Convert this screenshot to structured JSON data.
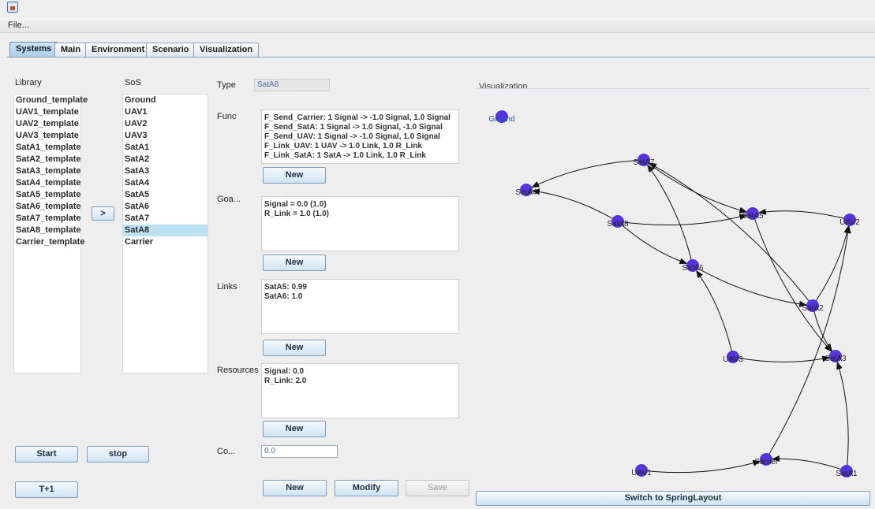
{
  "menu": {
    "file": "File..."
  },
  "tabs": [
    "Systems",
    "Main",
    "Environment",
    "Scenario",
    "Visualization"
  ],
  "library": {
    "label": "Library",
    "items": [
      "Ground_template",
      "UAV1_template",
      "UAV2_template",
      "UAV3_template",
      "SatA1_template",
      "SatA2_template",
      "SatA3_template",
      "SatA4_template",
      "SatA5_template",
      "SatA6_template",
      "SatA7_template",
      "SatA8_template",
      "Carrier_template"
    ]
  },
  "sos": {
    "label": "SoS",
    "items": [
      "Ground",
      "UAV1",
      "UAV2",
      "UAV3",
      "SatA1",
      "SatA2",
      "SatA3",
      "SatA4",
      "SatA5",
      "SatA6",
      "SatA7",
      "SatA8",
      "Carrier"
    ],
    "selected": "SatA8"
  },
  "transfer_button": ">",
  "detail": {
    "type_label": "Type",
    "type_value": "SatA8",
    "func_label": "Func",
    "func_lines": [
      "F_Send_Carrier: 1 Signal -> -1.0 Signal, 1.0 Signal",
      "F_Send_SatA: 1 Signal -> 1.0 Signal, -1.0 Signal",
      "F_Send_UAV: 1 Signal -> -1.0 Signal, 1.0 Signal",
      "F_Link_UAV: 1 UAV -> 1.0 Link, 1.0 R_Link",
      "F_Link_SatA: 1 SatA -> 1.0 Link, 1.0 R_Link"
    ],
    "goals_label": "Goa...",
    "goals_lines": [
      "Signal = 0.0 (1.0)",
      "R_Link = 1.0 (1.0)"
    ],
    "links_label": "Links",
    "links_lines": [
      "SatA5: 0.99",
      "SatA6: 1.0"
    ],
    "resources_label": "Resources",
    "resources_lines": [
      "Signal: 0.0",
      "R_Link: 2.0"
    ],
    "cost_label": "Co...",
    "cost_value": "0.0",
    "new_label": "New"
  },
  "buttons": {
    "start": "Start",
    "stop": "stop",
    "tplus": "T+1",
    "new": "New",
    "modify": "Modify",
    "save": "Save",
    "switch_layout": "Switch to SpringLayout"
  },
  "visualization": {
    "title": "Visualization",
    "node_color": "#5533dd",
    "nodes": [
      "Ground",
      "SatA7",
      "SatA4",
      "SatA8",
      "SatA5",
      "UAV2",
      "SatA6",
      "SatA2",
      "UAV3",
      "SatA3",
      "Carrier",
      "UAV1",
      "SatA1"
    ],
    "edges": [
      [
        "SatA7",
        "SatA4"
      ],
      [
        "SatA8",
        "SatA4"
      ],
      [
        "SatA8",
        "SatA5"
      ],
      [
        "SatA7",
        "SatA5"
      ],
      [
        "SatA6",
        "SatA7"
      ],
      [
        "SatA8",
        "SatA6"
      ],
      [
        "UAV2",
        "SatA5"
      ],
      [
        "SatA5",
        "SatA3"
      ],
      [
        "SatA2",
        "SatA7"
      ],
      [
        "SatA6",
        "SatA2"
      ],
      [
        "UAV3",
        "SatA6"
      ],
      [
        "UAV3",
        "SatA3"
      ],
      [
        "SatA2",
        "SatA3"
      ],
      [
        "SatA2",
        "UAV2"
      ],
      [
        "Carrier",
        "UAV2"
      ],
      [
        "UAV1",
        "Carrier"
      ],
      [
        "SatA1",
        "Carrier"
      ],
      [
        "SatA1",
        "SatA3"
      ]
    ]
  }
}
